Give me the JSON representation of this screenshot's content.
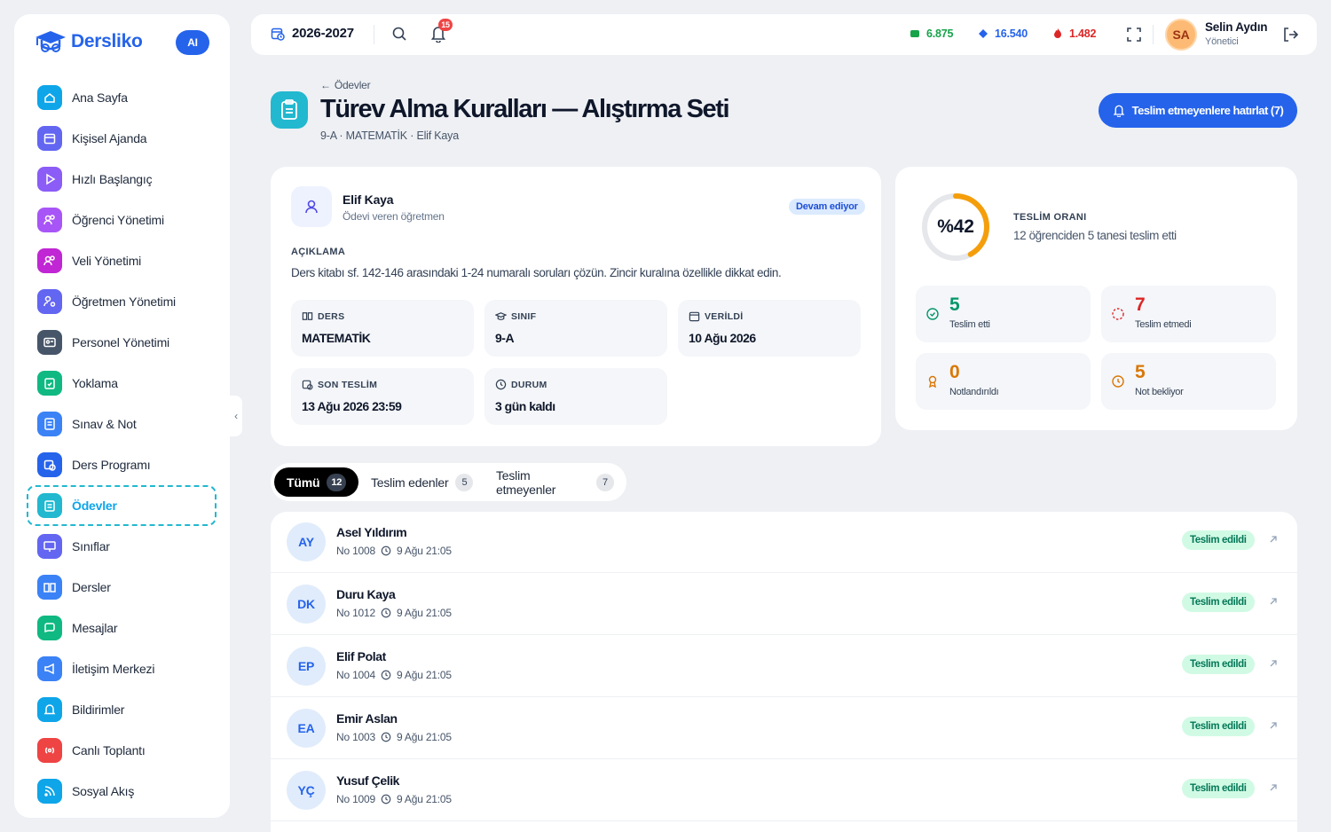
{
  "app": {
    "name": "Dersliko",
    "ai_label": "AI"
  },
  "sidebar": {
    "items": [
      {
        "label": "Ana Sayfa",
        "icon": "home-icon",
        "color": "#0ea5e9"
      },
      {
        "label": "Kişisel Ajanda",
        "icon": "calendar-icon",
        "color": "#6366f1"
      },
      {
        "label": "Hızlı Başlangıç",
        "icon": "play-icon",
        "color": "#8b5cf6"
      },
      {
        "label": "Öğrenci Yönetimi",
        "icon": "users-icon",
        "color": "#a855f7"
      },
      {
        "label": "Veli Yönetimi",
        "icon": "users-icon",
        "color": "#c026d3"
      },
      {
        "label": "Öğretmen Yönetimi",
        "icon": "user-cog-icon",
        "color": "#6366f1"
      },
      {
        "label": "Personel Yönetimi",
        "icon": "id-card-icon",
        "color": "#475569"
      },
      {
        "label": "Yoklama",
        "icon": "clipboard-check-icon",
        "color": "#10b981"
      },
      {
        "label": "Sınav & Not",
        "icon": "exam-icon",
        "color": "#3b82f6"
      },
      {
        "label": "Ders Programı",
        "icon": "calendar-clock-icon",
        "color": "#2563eb"
      },
      {
        "label": "Ödevler",
        "icon": "clipboard-list-icon",
        "color": "#22b8cf",
        "active": true
      },
      {
        "label": "Sınıflar",
        "icon": "presentation-icon",
        "color": "#6366f1"
      },
      {
        "label": "Dersler",
        "icon": "book-open-icon",
        "color": "#3b82f6"
      },
      {
        "label": "Mesajlar",
        "icon": "message-icon",
        "color": "#10b981"
      },
      {
        "label": "İletişim Merkezi",
        "icon": "megaphone-icon",
        "color": "#3b82f6"
      },
      {
        "label": "Bildirimler",
        "icon": "bell-icon",
        "color": "#0ea5e9"
      },
      {
        "label": "Canlı Toplantı",
        "icon": "broadcast-icon",
        "color": "#ef4444"
      },
      {
        "label": "Sosyal Akış",
        "icon": "rss-icon",
        "color": "#0ea5e9"
      }
    ]
  },
  "topbar": {
    "year": "2026-2027",
    "notifications": "15",
    "coins": [
      {
        "value": "6.875",
        "icon": "green-gem-icon",
        "color": "#16a34a"
      },
      {
        "value": "16.540",
        "icon": "blue-diamond-icon",
        "color": "#2563eb"
      },
      {
        "value": "1.482",
        "icon": "fire-icon",
        "color": "#dc2626"
      }
    ],
    "user": {
      "initials": "SA",
      "name": "Selin Aydın",
      "role": "Yönetici"
    }
  },
  "page": {
    "back": "Ödevler",
    "title": "Türev Alma Kuralları — Alıştırma Seti",
    "subtitle": "9-A · MATEMATİK · Elif Kaya",
    "remind_button": "Teslim etmeyenlere hatırlat (7)"
  },
  "details": {
    "teacher_name": "Elif Kaya",
    "teacher_role": "Ödevi veren öğretmen",
    "status": "Devam ediyor",
    "desc_label": "AÇIKLAMA",
    "description": "Ders kitabı sf. 142-146 arasındaki 1-24 numaralı soruları çözün. Zincir kuralına özellikle dikkat edin.",
    "fields": [
      {
        "label": "DERS",
        "value": "MATEMATİK",
        "icon": "book-icon"
      },
      {
        "label": "SINIF",
        "value": "9-A",
        "icon": "graduation-cap-icon"
      },
      {
        "label": "VERİLDİ",
        "value": "10 Ağu 2026",
        "icon": "calendar-icon"
      },
      {
        "label": "SON TESLİM",
        "value": "13 Ağu 2026 23:59",
        "icon": "calendar-clock-icon"
      },
      {
        "label": "DURUM",
        "value": "3 gün kaldı",
        "icon": "clock-icon"
      }
    ]
  },
  "stats": {
    "percent_label": "%42",
    "percent": 0.42,
    "rate_label": "TESLİM ORANI",
    "rate_text": "12 öğrenciden 5 tanesi teslim etti",
    "cards": [
      {
        "num": "5",
        "label": "Teslim etti",
        "color": "#059669",
        "icon": "check-circle-icon"
      },
      {
        "num": "7",
        "label": "Teslim etmedi",
        "color": "#dc2626",
        "icon": "dashed-circle-icon"
      },
      {
        "num": "0",
        "label": "Notlandırıldı",
        "color": "#d97706",
        "icon": "award-icon"
      },
      {
        "num": "5",
        "label": "Not bekliyor",
        "color": "#d97706",
        "icon": "clock-icon"
      }
    ]
  },
  "tabs": [
    {
      "label": "Tümü",
      "count": "12"
    },
    {
      "label": "Teslim edenler",
      "count": "5"
    },
    {
      "label": "Teslim etmeyenler",
      "count": "7"
    }
  ],
  "submissions": [
    {
      "initials": "AY",
      "name": "Asel Yıldırım",
      "no": "No 1008",
      "time": "9 Ağu 21:05",
      "status": "Teslim edildi"
    },
    {
      "initials": "DK",
      "name": "Duru Kaya",
      "no": "No 1012",
      "time": "9 Ağu 21:05",
      "status": "Teslim edildi"
    },
    {
      "initials": "EP",
      "name": "Elif Polat",
      "no": "No 1004",
      "time": "9 Ağu 21:05",
      "status": "Teslim edildi"
    },
    {
      "initials": "EA",
      "name": "Emir Aslan",
      "no": "No 1003",
      "time": "9 Ağu 21:05",
      "status": "Teslim edildi"
    },
    {
      "initials": "YÇ",
      "name": "Yusuf Çelik",
      "no": "No 1009",
      "time": "9 Ağu 21:05",
      "status": "Teslim edildi"
    }
  ]
}
